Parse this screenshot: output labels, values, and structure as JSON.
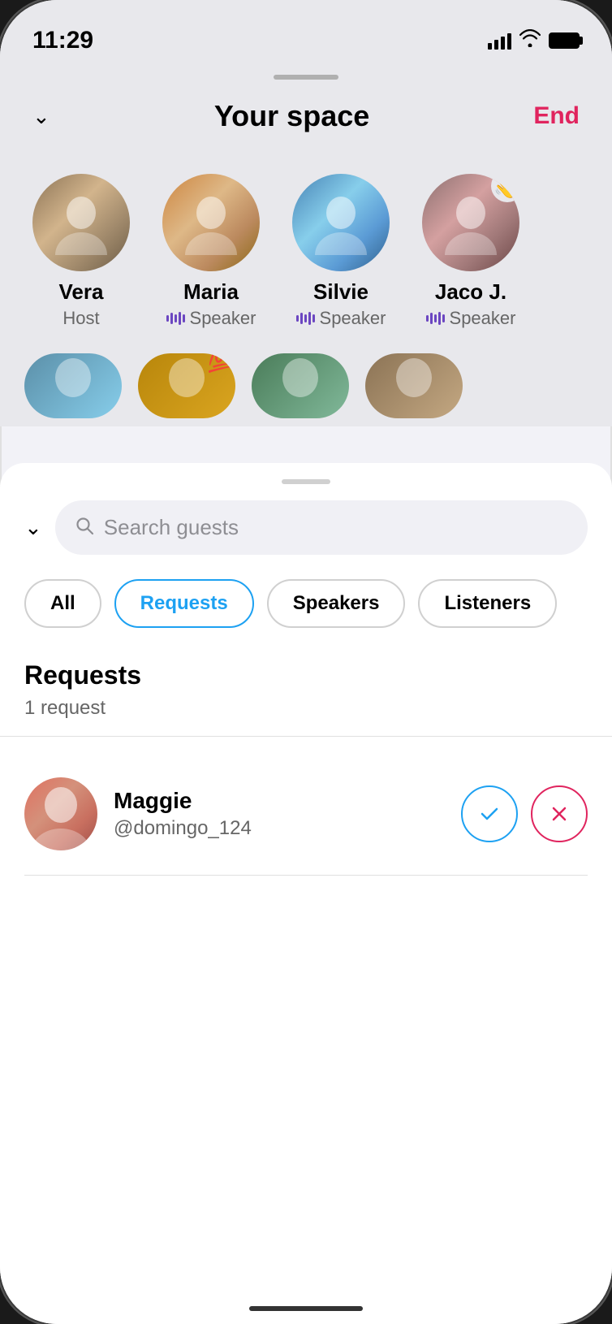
{
  "statusBar": {
    "time": "11:29",
    "batteryFull": true
  },
  "header": {
    "title": "Your space",
    "endLabel": "End",
    "chevronDown": "chevron-down"
  },
  "speakers": [
    {
      "id": "vera",
      "name": "Vera",
      "role": "Host",
      "hasMic": false
    },
    {
      "id": "maria",
      "name": "Maria",
      "role": "Speaker",
      "hasMic": true
    },
    {
      "id": "silvie",
      "name": "Silvie",
      "role": "Speaker",
      "hasMic": true
    },
    {
      "id": "jaco",
      "name": "Jaco J.",
      "role": "Speaker",
      "hasMic": true,
      "hasWave": true
    }
  ],
  "searchBar": {
    "placeholder": "Search guests"
  },
  "filterTabs": [
    {
      "id": "all",
      "label": "All",
      "active": false
    },
    {
      "id": "requests",
      "label": "Requests",
      "active": true
    },
    {
      "id": "speakers",
      "label": "Speakers",
      "active": false
    },
    {
      "id": "listeners",
      "label": "Listeners",
      "active": false
    }
  ],
  "requestsSection": {
    "title": "Requests",
    "countLabel": "1 request"
  },
  "requests": [
    {
      "id": "maggie",
      "name": "Maggie",
      "handle": "@domingo_124"
    }
  ]
}
